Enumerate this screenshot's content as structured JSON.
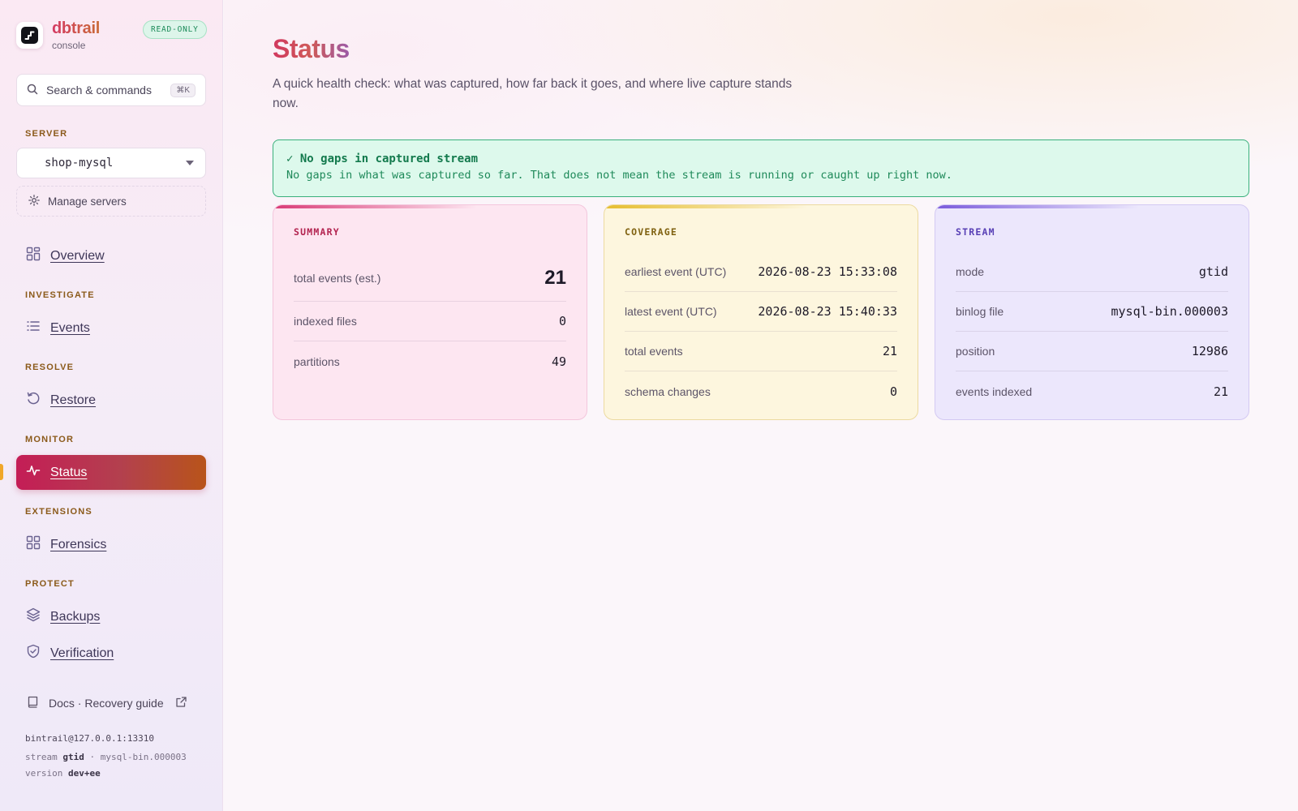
{
  "brand": {
    "name": "dbtrail",
    "subtitle": "console",
    "badge": "READ-ONLY"
  },
  "search": {
    "label": "Search & commands",
    "shortcut": "⌘K"
  },
  "server": {
    "section_label": "SERVER",
    "selected": "shop-mysql",
    "manage_label": "Manage servers"
  },
  "nav": {
    "overview": {
      "label": "Overview"
    },
    "investigate": {
      "section_label": "INVESTIGATE",
      "events": "Events"
    },
    "resolve": {
      "section_label": "RESOLVE",
      "restore": "Restore"
    },
    "monitor": {
      "section_label": "MONITOR",
      "status": "Status"
    },
    "extensions": {
      "section_label": "EXTENSIONS",
      "forensics": "Forensics"
    },
    "protect": {
      "section_label": "PROTECT",
      "backups": "Backups",
      "verification": "Verification"
    }
  },
  "docs": {
    "label": "Docs · Recovery guide"
  },
  "footer": {
    "connection": "bintrail@127.0.0.1:13310",
    "stream_prefix": "stream",
    "stream_mode": "gtid",
    "stream_file": "· mysql-bin.000003",
    "version_prefix": "version",
    "version": "dev+ee"
  },
  "page": {
    "title": "Status",
    "description": "A quick health check: what was captured, how far back it goes, and where live capture stands now."
  },
  "banner": {
    "title": "✓ No gaps in captured stream",
    "text": "No gaps in what was captured so far. That does not mean the stream is running or caught up right now."
  },
  "cards": {
    "summary": {
      "title": "SUMMARY",
      "rows": [
        {
          "key": "total events (est.)",
          "value": "21"
        },
        {
          "key": "indexed files",
          "value": "0"
        },
        {
          "key": "partitions",
          "value": "49"
        }
      ]
    },
    "coverage": {
      "title": "COVERAGE",
      "rows": [
        {
          "key": "earliest event (UTC)",
          "value": "2026-08-23 15:33:08"
        },
        {
          "key": "latest event (UTC)",
          "value": "2026-08-23 15:40:33"
        },
        {
          "key": "total events",
          "value": "21"
        },
        {
          "key": "schema changes",
          "value": "0"
        }
      ]
    },
    "stream": {
      "title": "STREAM",
      "rows": [
        {
          "key": "mode",
          "value": "gtid"
        },
        {
          "key": "binlog file",
          "value": "mysql-bin.000003"
        },
        {
          "key": "position",
          "value": "12986"
        },
        {
          "key": "events indexed",
          "value": "21"
        }
      ]
    }
  },
  "colors": {
    "accent": "#c41d56",
    "accent_end": "#b8541a",
    "success": "#39b07c",
    "summary_accent": "#d93c77",
    "coverage_accent": "#e6bd2f",
    "stream_accent": "#7b5cdb"
  }
}
